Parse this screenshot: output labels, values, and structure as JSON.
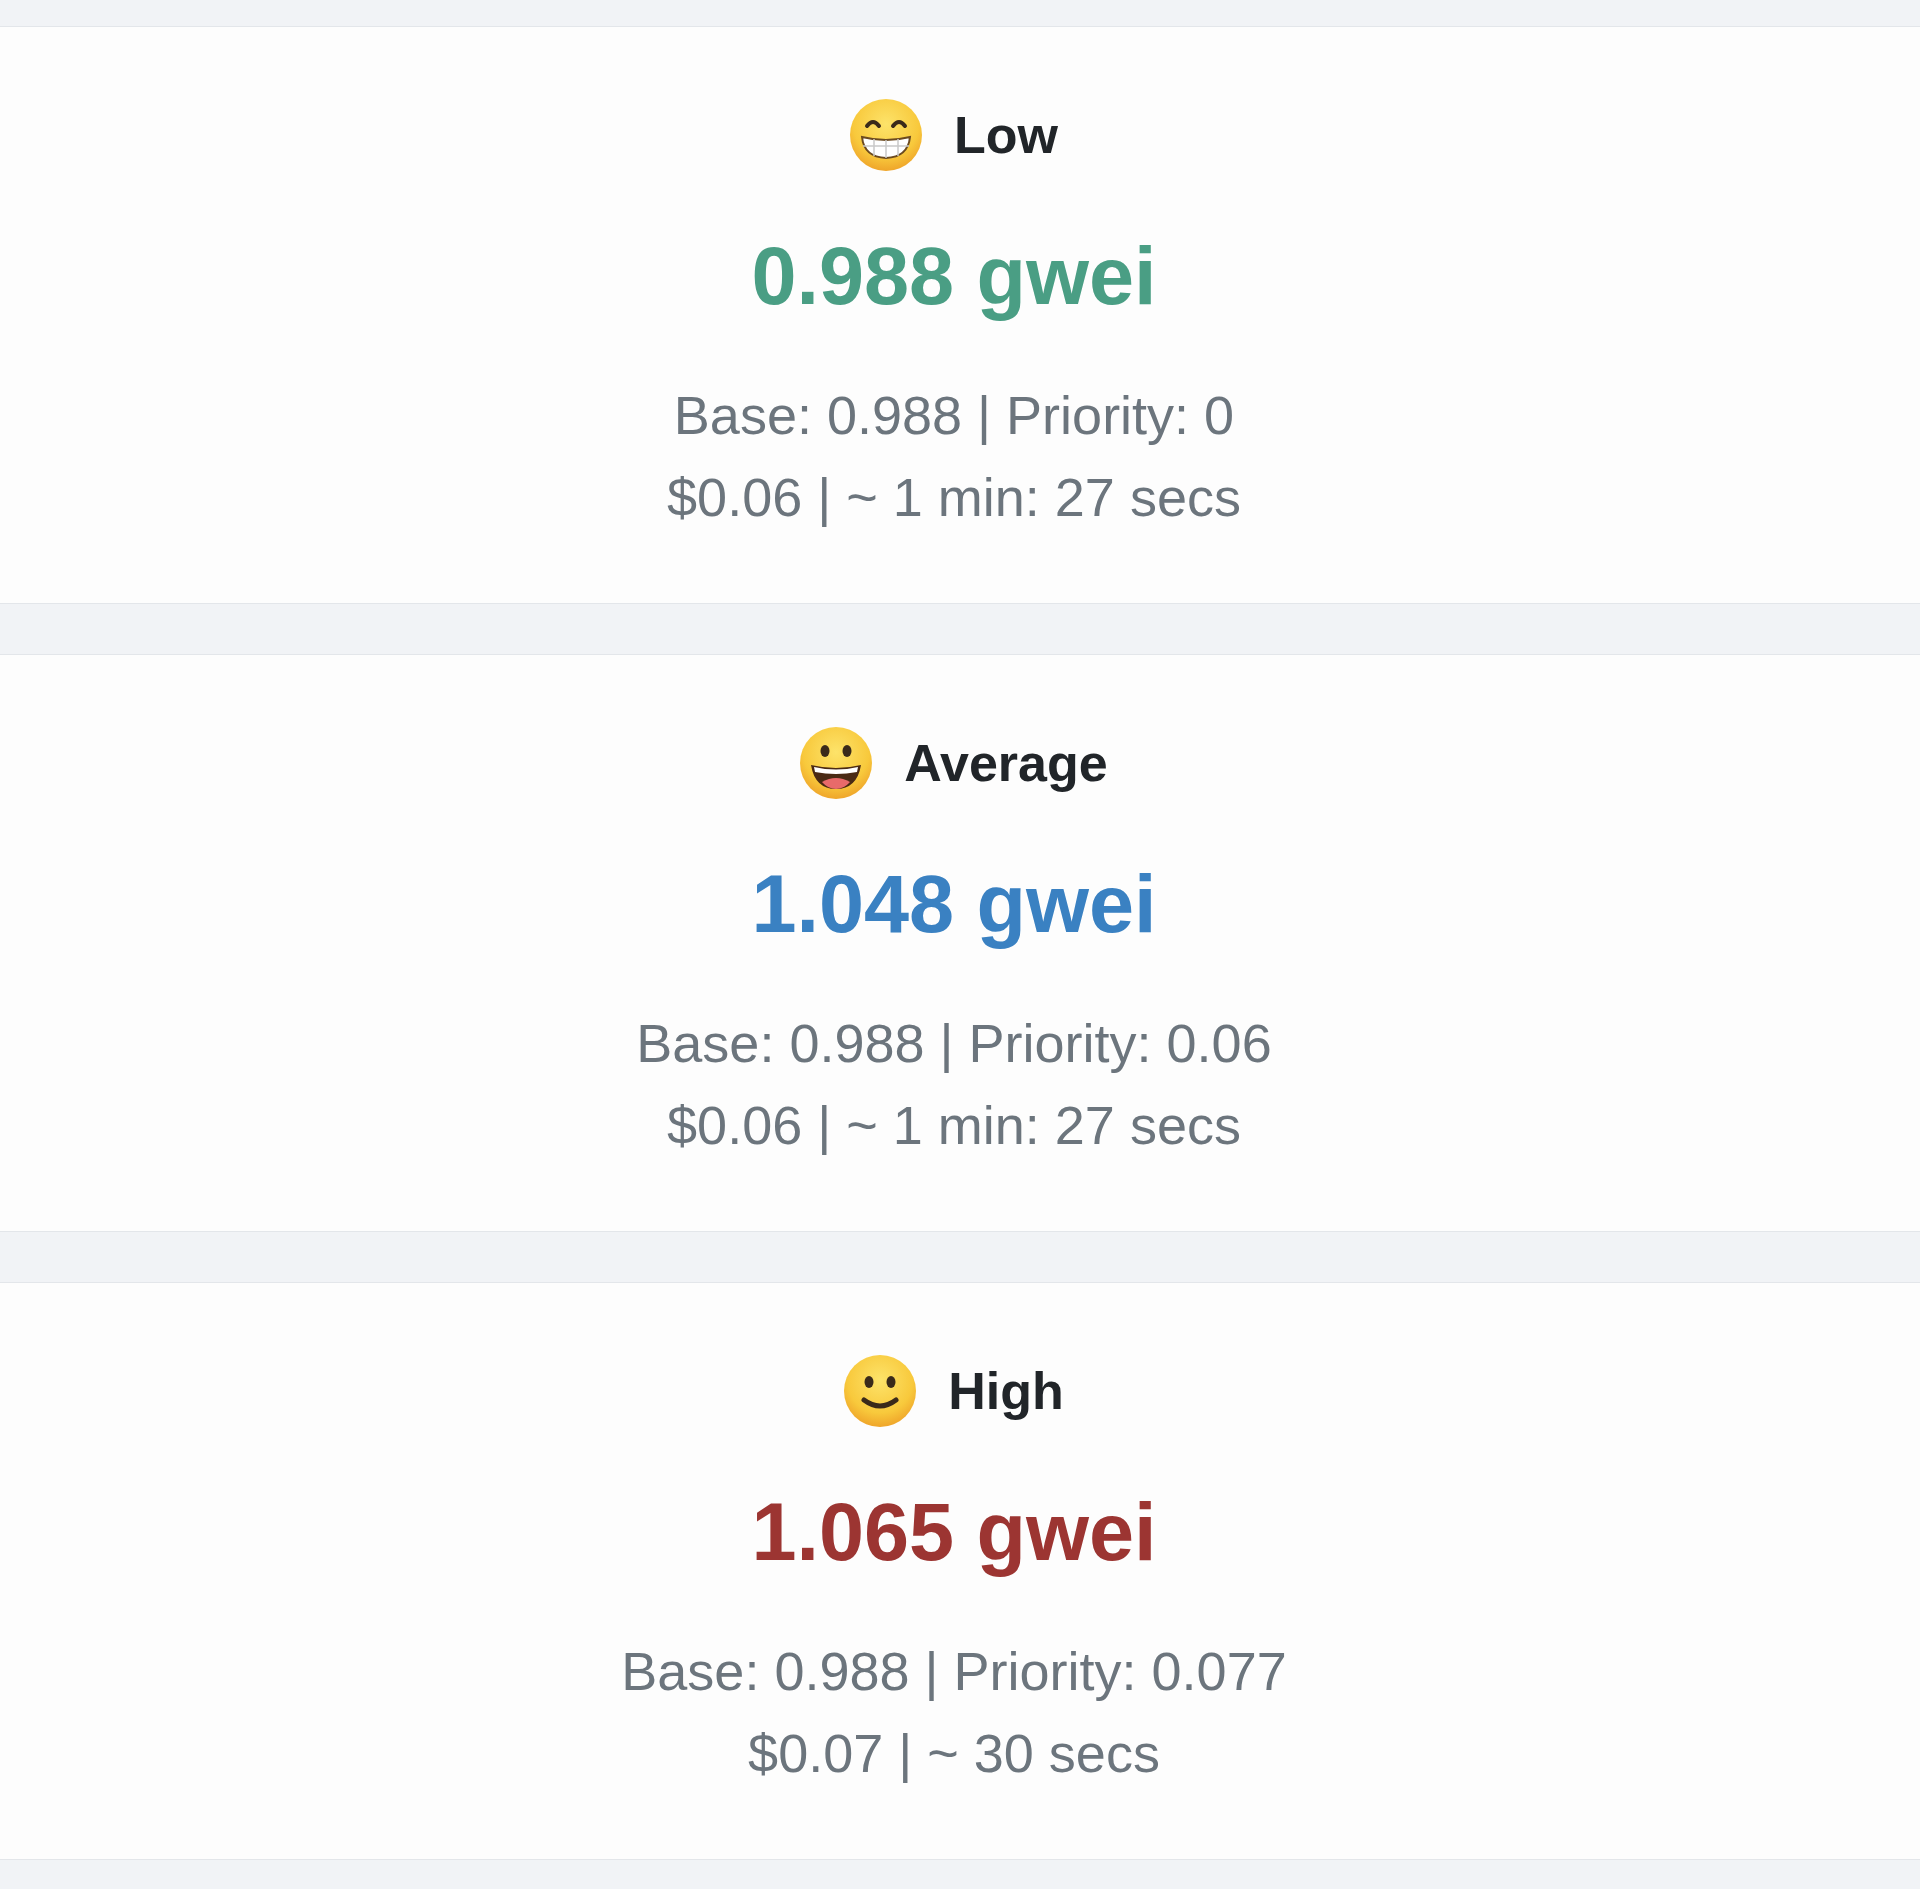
{
  "tiers": [
    {
      "kind": "low",
      "title": "Low",
      "price": "0.988 gwei",
      "color": "#4a9e84",
      "breakdown": "Base: 0.988 | Priority: 0",
      "estimate": "$0.06 | ~ 1 min: 27 secs"
    },
    {
      "kind": "average",
      "title": "Average",
      "price": "1.048 gwei",
      "color": "#3a81c2",
      "breakdown": "Base: 0.988 | Priority: 0.06",
      "estimate": "$0.06 | ~ 1 min: 27 secs"
    },
    {
      "kind": "high",
      "title": "High",
      "price": "1.065 gwei",
      "color": "#9c3532",
      "breakdown": "Base: 0.988 | Priority: 0.077",
      "estimate": "$0.07 | ~ 30 secs"
    }
  ]
}
